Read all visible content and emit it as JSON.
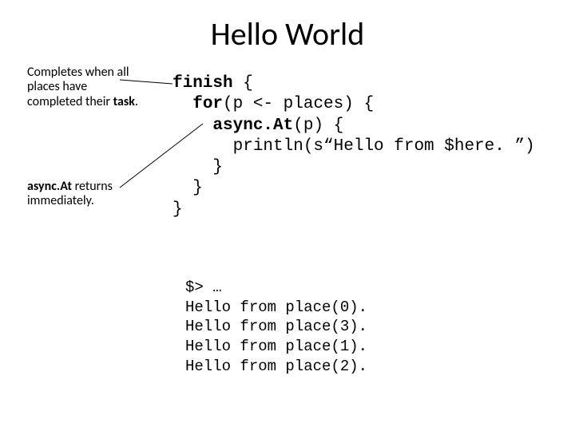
{
  "title": "Hello World",
  "annotations": {
    "finish": {
      "plain1": "Completes when all places have completed their ",
      "bold_word": "task",
      "plain2": "."
    },
    "asyncAt": {
      "bold_word": "async.At",
      "plain": " returns immediately."
    }
  },
  "code": {
    "l1_kw": "finish",
    "l1_rest": " {",
    "l2_indent": "  ",
    "l2_kw": "for",
    "l2_rest": "(p <- places) {",
    "l3_indent": "    ",
    "l3_kw": "async.At",
    "l3_rest": "(p) {",
    "l4": "      println(s“Hello from $here. ”)",
    "l5": "    }",
    "l6": "  }",
    "l7": "}"
  },
  "output": {
    "l1": "$> …",
    "l2": "Hello from place(0).",
    "l3": "Hello from place(3).",
    "l4": "Hello from place(1).",
    "l5": "Hello from place(2)."
  }
}
